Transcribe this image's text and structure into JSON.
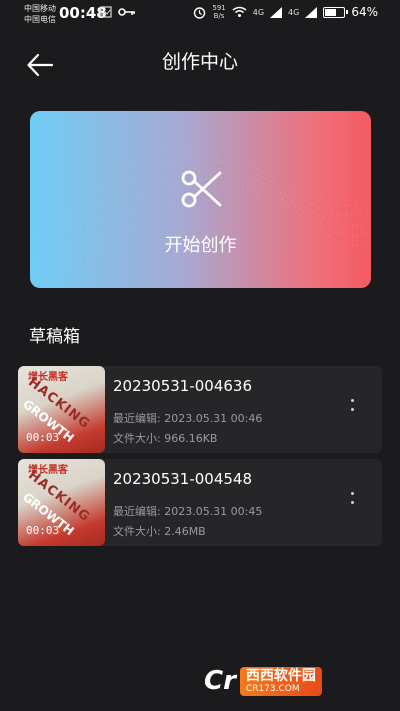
{
  "status": {
    "carrier1": "中国移动",
    "carrier2": "中国电信",
    "time": "00:48",
    "speed_value": "591",
    "speed_unit": "B/s",
    "signal1": "4G",
    "signal2": "4G",
    "battery": "64%",
    "battery_level": 0.64
  },
  "header": {
    "title": "创作中心"
  },
  "hero": {
    "label": "开始创作",
    "colors": [
      "#6fcdf5",
      "#f45a64"
    ]
  },
  "drafts": {
    "title": "草稿箱",
    "items": [
      {
        "name": "20230531-004636",
        "duration": "00:03",
        "edited": "最近编辑: 2023.05.31 00:46",
        "size": "文件大小:  966.16KB"
      },
      {
        "name": "20230531-004548",
        "duration": "00:03",
        "edited": "最近编辑: 2023.05.31 00:45",
        "size": "文件大小:  2.46MB"
      }
    ],
    "thumb_text": {
      "top": "增长黑客",
      "mid": "HACKING",
      "bottom": "GROWTH"
    }
  },
  "watermark": {
    "logo": "Cr",
    "name": "西西软件园",
    "url": "CR173.COM"
  }
}
